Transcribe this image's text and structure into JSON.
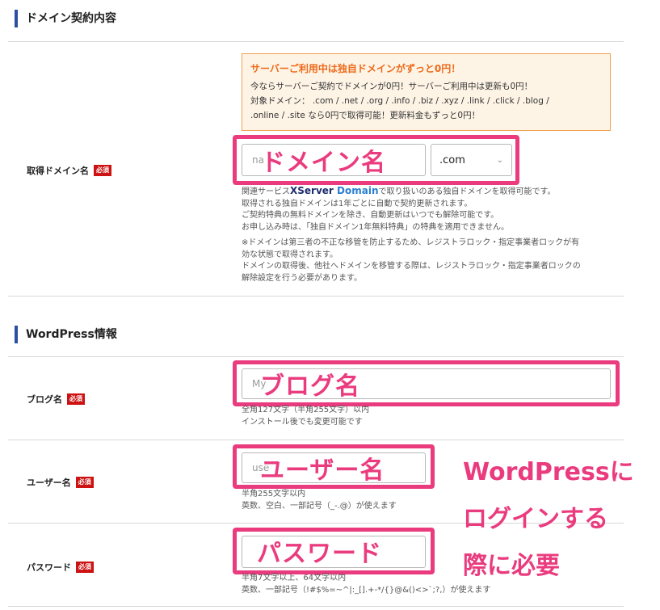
{
  "domain_section": {
    "title": "ドメイン契約内容",
    "field_label": "取得ドメイン名",
    "required_badge": "必須",
    "promo": {
      "title": "サーバーご利用中は独自ドメインがずっと0円！",
      "lines": [
        "今ならサーバーご契約でドメインが0円！サーバーご利用中は更新も0円！",
        "対象ドメイン： .com / .net / .org / .info / .biz / .xyz / .link / .click / .blog /",
        ".online / .site なら0円で取得可能！更新料金もずっと0円！"
      ]
    },
    "domain_input_placeholder": "na",
    "tld_select_value": ".com",
    "overlay_label": "ドメイン名",
    "help_prefix": "関連サービス",
    "brand_x": "XServer",
    "brand_domain": "Domain",
    "help_line1_suffix": "で取り扱いのある独自ドメインを取得可能です。",
    "help_lines_a": [
      "取得される独自ドメインは1年ごとに自動で契約更新されます。",
      "ご契約特典の無料ドメインを除き、自動更新はいつでも解除可能です。",
      "お申し込み時は、「独自ドメイン1年無料特典」の特典を適用できません。"
    ],
    "help_lines_b": [
      "※ドメインは第三者の不正な移管を防止するため、レジストラロック・指定事業者ロックが有",
      "効な状態で取得されます。",
      "ドメインの取得後、他社へドメインを移管する際は、レジストラロック・指定事業者ロックの",
      "解除設定を行う必要があります。"
    ]
  },
  "wp_section": {
    "title": "WordPress情報",
    "required_badge": "必須",
    "blog": {
      "label": "ブログ名",
      "placeholder": "My",
      "overlay_label": "ブログ名",
      "help": [
        "全角127文字（半角255文字）以内",
        "インストール後でも変更可能です"
      ]
    },
    "user": {
      "label": "ユーザー名",
      "placeholder": "use",
      "overlay_label": "ユーザー名",
      "help": [
        "半角255文字以内",
        "英数、空白、一部記号（_-.@）が使えます"
      ]
    },
    "password": {
      "label": "パスワード",
      "placeholder": "",
      "overlay_label": "パスワード",
      "help": [
        "半角7文字以上、64文字以内",
        "英数、一部記号（!#$%=~^|:_[].+-*/{}@&()<>`;?,）が使えます"
      ]
    }
  },
  "annotation_lines": [
    "WordPressに",
    "ログインする",
    "際に必要"
  ],
  "colors": {
    "accent_pink": "#ea3b7e",
    "section_bar": "#2b4fa3",
    "required_red": "#cc1212",
    "promo_orange": "#ee6a1a"
  }
}
